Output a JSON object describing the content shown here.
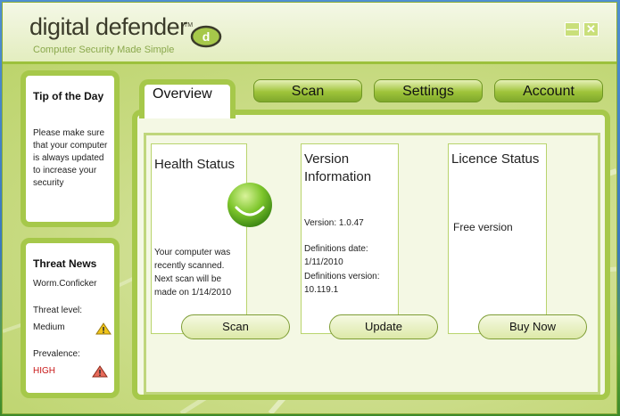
{
  "app": {
    "name": "digital defender",
    "tm": "TM",
    "tagline": "Computer Security Made Simple",
    "badge_letter": "d"
  },
  "window_controls": {
    "minimize": "—",
    "close": "✕"
  },
  "tabs": [
    {
      "label": "Overview",
      "active": true
    },
    {
      "label": "Scan"
    },
    {
      "label": "Settings"
    },
    {
      "label": "Account"
    }
  ],
  "tip": {
    "title": "Tip of the Day",
    "text": "Please make sure that your computer is always updated to increase your security"
  },
  "threat_news": {
    "title": "Threat News",
    "threat_name": "Worm.Conficker",
    "level_label": "Threat level:",
    "level_value": "Medium",
    "prevalence_label": "Prevalence:",
    "prevalence_value": "HIGH"
  },
  "health": {
    "title": "Health Status",
    "text_lines": [
      "Your computer was",
      "recently scanned.",
      "Next scan will be",
      "made on 1/14/2010"
    ],
    "button": "Scan"
  },
  "version": {
    "title_lines": [
      "Version",
      "Information"
    ],
    "version_line": "Version: 1.0.47",
    "def_date_lines": [
      "Definitions date:",
      "1/11/2010"
    ],
    "def_version_lines": [
      "Definitions version:",
      "10.119.1"
    ],
    "button": "Update"
  },
  "licence": {
    "title": "Licence Status",
    "status": "Free version",
    "button": "Buy Now"
  },
  "colors": {
    "accent_green": "#a6c84a",
    "warning_yellow": "#f0c419",
    "danger_red": "#c81818"
  }
}
